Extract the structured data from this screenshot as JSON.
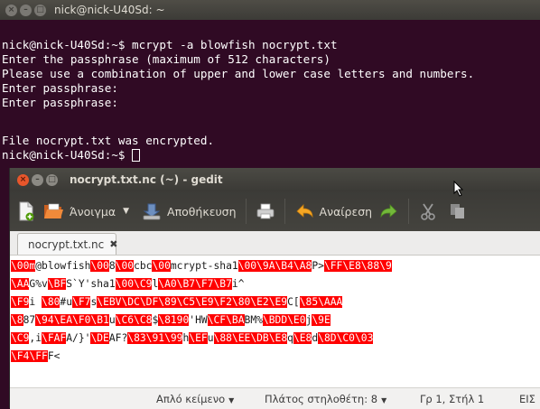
{
  "terminal": {
    "title": "nick@nick-U40Sd: ~",
    "lines": [
      "nick@nick-U40Sd:~$ mcrypt -a blowfish nocrypt.txt",
      "Enter the passphrase (maximum of 512 characters)",
      "Please use a combination of upper and lower case letters and numbers.",
      "Enter passphrase:",
      "Enter passphrase:",
      "",
      "File nocrypt.txt was encrypted.",
      "nick@nick-U40Sd:~$ "
    ]
  },
  "gedit": {
    "title": "nocrypt.txt.nc (~) - gedit",
    "toolbar": {
      "new_label": "",
      "open_label": "Άνοιγμα",
      "save_label": "Αποθήκευση",
      "undo_label": "Αναίρεση"
    },
    "tab": {
      "label": "nocrypt.txt.nc"
    },
    "editor_lines": [
      [
        [
          "r",
          "\\00m"
        ],
        [
          "t",
          "@blowfish"
        ],
        [
          "r",
          "\\00"
        ],
        [
          "t",
          "8"
        ],
        [
          "r",
          "\\00"
        ],
        [
          "t",
          "cbc"
        ],
        [
          "r",
          "\\00"
        ],
        [
          "t",
          "mcrypt-sha1"
        ],
        [
          "r",
          "\\00\\9A\\B4\\A8"
        ],
        [
          "t",
          "P>"
        ],
        [
          "r",
          "\\FF\\E8\\88\\9"
        ]
      ],
      [
        [
          "r",
          "\\AA"
        ],
        [
          "t",
          "G%v"
        ],
        [
          "r",
          "\\BF"
        ],
        [
          "t",
          "S`Y'sha1"
        ],
        [
          "r",
          "\\00\\C9"
        ],
        [
          "t",
          "l"
        ],
        [
          "r",
          "\\A0\\B7\\F7\\B7"
        ],
        [
          "t",
          "i^"
        ]
      ],
      [
        [
          "r",
          "\\F9"
        ],
        [
          "t",
          "i "
        ],
        [
          "r",
          "\\80"
        ],
        [
          "t",
          "#"
        ],
        [
          "t",
          "u"
        ],
        [
          "r",
          "\\F7"
        ],
        [
          "t",
          "s"
        ],
        [
          "r",
          "\\EBV\\DC\\DF\\89\\C5\\E9\\F2\\80\\E2\\E9"
        ],
        [
          "t",
          "C["
        ],
        [
          "r",
          "\\85\\AAA"
        ]
      ],
      [
        [
          "r",
          "\\8"
        ],
        [
          "t",
          "87"
        ],
        [
          "r",
          "\\94\\EA\\F0\\B1"
        ],
        [
          "t",
          "u"
        ],
        [
          "r",
          "\\C6\\C8"
        ],
        [
          "t",
          "$"
        ],
        [
          "r",
          "\\8190"
        ],
        [
          "t",
          "'HW"
        ],
        [
          "r",
          "\\CF\\BA"
        ],
        [
          "t",
          "BM%"
        ],
        [
          "r",
          "\\BDD\\E0"
        ],
        [
          "t",
          "j"
        ],
        [
          "r",
          "\\9E"
        ]
      ],
      [
        [
          "r",
          "\\C9"
        ],
        [
          "t",
          ",i"
        ],
        [
          "r",
          "\\FAF"
        ],
        [
          "t",
          "A/}'"
        ],
        [
          "r",
          "\\DE"
        ],
        [
          "t",
          "AF?"
        ],
        [
          "r",
          "\\83\\91\\99"
        ],
        [
          "t",
          "h"
        ],
        [
          "r",
          "\\EF"
        ],
        [
          "t",
          "u"
        ],
        [
          "r",
          "\\88\\EE\\DB\\E8"
        ],
        [
          "t",
          "q"
        ],
        [
          "r",
          "\\E8"
        ],
        [
          "t",
          "d"
        ],
        [
          "r",
          "\\8D\\C0\\03"
        ]
      ],
      [
        [
          "r",
          "\\F4\\FF"
        ],
        [
          "t",
          "F<"
        ]
      ]
    ],
    "status": {
      "syntax": "Απλό κείμενο",
      "tab_width": "Πλάτος στηλοθέτη: 8",
      "position": "Γρ 1, Στήλ 1",
      "mode": "ΕΙΣ"
    }
  },
  "colors": {
    "terminal_bg": "#300a24",
    "highlight_red": "#ff0000",
    "close_orange": "#e8562b"
  }
}
